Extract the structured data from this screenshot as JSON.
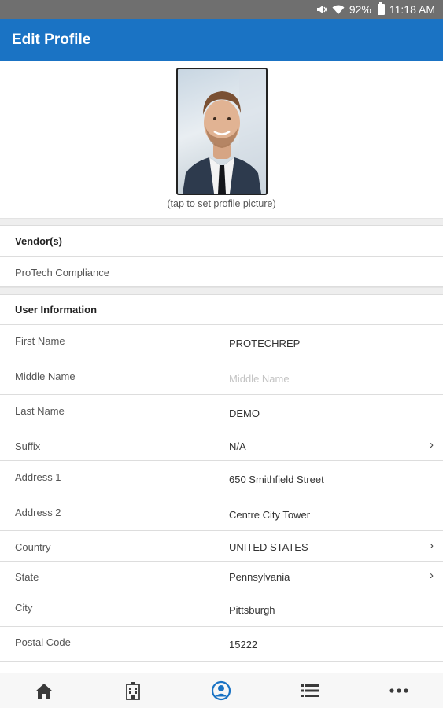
{
  "status_bar": {
    "battery": "92%",
    "time": "11:18 AM"
  },
  "header": {
    "title": "Edit Profile"
  },
  "profile": {
    "photo_hint": "(tap to set profile picture)"
  },
  "vendors": {
    "title": "Vendor(s)",
    "item": "ProTech Compliance"
  },
  "user_info": {
    "title": "User Information",
    "fields": [
      {
        "label": "First Name",
        "value": "PROTECHREP"
      },
      {
        "label": "Middle Name",
        "value": "",
        "placeholder": "Middle Name"
      },
      {
        "label": "Last Name",
        "value": "DEMO"
      },
      {
        "label": "Suffix",
        "value": "N/A"
      },
      {
        "label": "Address 1",
        "value": "650 Smithfield Street"
      },
      {
        "label": "Address 2",
        "value": "Centre City Tower"
      },
      {
        "label": "Country",
        "value": "UNITED STATES"
      },
      {
        "label": "State",
        "value": "Pennsylvania"
      },
      {
        "label": "City",
        "value": "Pittsburgh"
      },
      {
        "label": "Postal Code",
        "value": "15222"
      }
    ]
  },
  "nav": {
    "items": [
      "home-icon",
      "building-icon",
      "profile-icon",
      "list-icon",
      "more-icon"
    ],
    "active": "profile-icon"
  },
  "colors": {
    "primary": "#1a73c4",
    "status_bar": "#6f6f6f",
    "active_nav": "#1a73c4",
    "nav_icon": "#3a3a3a"
  }
}
